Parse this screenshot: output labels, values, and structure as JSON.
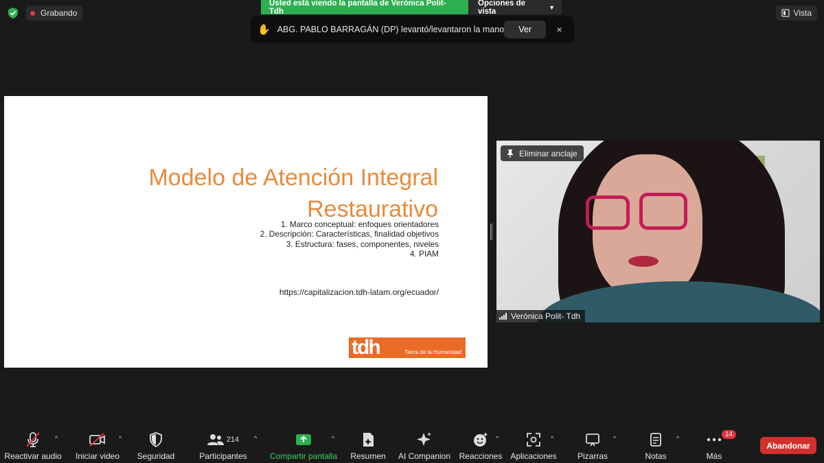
{
  "top": {
    "recording_label": "Grabando",
    "share_banner": "Usted está viendo la pantalla de Verónica Polit- Tdh",
    "view_options_label": "Opciones de vista",
    "view_label": "Vista"
  },
  "notification": {
    "message": "ABG. PABLO BARRAGÁN (DP) levantó/levantaron la mano",
    "view_button": "Ver",
    "close_glyph": "×"
  },
  "slide": {
    "title_line1": "Modelo de Atención Integral",
    "title_line2": "Restaurativo",
    "items": [
      "1. Marco conceptual: enfoques orientadores",
      "2. Descripción: Características, finalidad objetivos",
      "3. Estructura: fases, componentes, niveles",
      "4. PIAM"
    ],
    "url": "https://capitalizacion.tdh-latam.org/ecuador/",
    "logo_text": "tdh",
    "logo_tagline": "Tierra de la Humanidad"
  },
  "video": {
    "unpin_label": "Eliminar anclaje",
    "participant_name": "Verónica Polit- Tdh"
  },
  "toolbar": {
    "audio": "Reactivar audio",
    "video": "Iniciar video",
    "security": "Seguridad",
    "participants": "Participantes",
    "participants_count": "214",
    "share": "Compartir pantalla",
    "summary": "Resumen",
    "ai": "AI Companion",
    "reactions": "Reacciones",
    "apps": "Aplicaciones",
    "whiteboards": "Pizarras",
    "notes": "Notas",
    "more": "Más",
    "more_badge": "14",
    "leave": "Abandonar"
  },
  "colors": {
    "background": "#1a1a1a",
    "banner_green": "#2dae50",
    "slide_title": "#e98a3b",
    "leave_red": "#d0312d",
    "share_green": "#3bd15f"
  }
}
